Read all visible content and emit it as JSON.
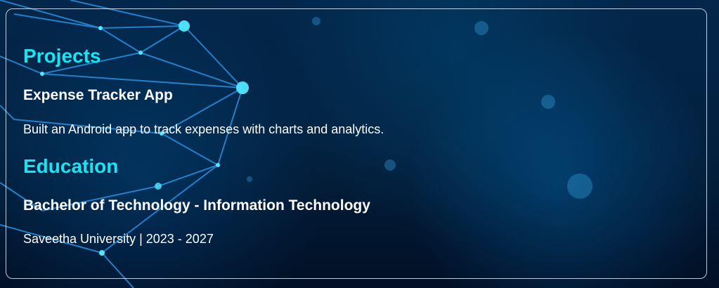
{
  "projects": {
    "heading": "Projects",
    "item": {
      "title": "Expense Tracker App",
      "description": "Built an Android app to track expenses with charts and analytics."
    }
  },
  "education": {
    "heading": "Education",
    "item": {
      "title": "Bachelor of Technology - Information Technology",
      "details": "Saveetha University | 2023 - 2027"
    }
  },
  "colors": {
    "heading": "#18e4f2",
    "text": "#ffffff",
    "background": "#03213f",
    "border": "#dcebff"
  }
}
